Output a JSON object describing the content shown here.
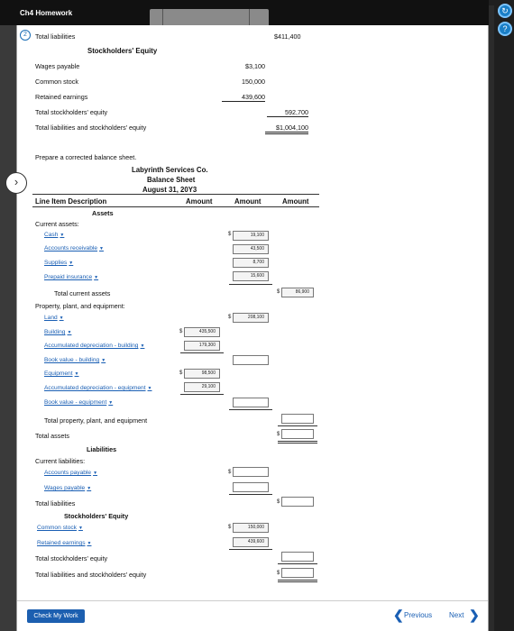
{
  "window": {
    "title": "Ch4 Homework"
  },
  "question": {
    "number": "2"
  },
  "top": {
    "total_liabilities_label": "Total liabilities",
    "total_liabilities_value": "$411,400",
    "se_heading": "Stockholders' Equity",
    "rows": [
      {
        "label": "Wages payable",
        "value": "$3,100"
      },
      {
        "label": "Common stock",
        "value": "150,000"
      },
      {
        "label": "Retained earnings",
        "value": "439,600"
      },
      {
        "label": "Total stockholders' equity",
        "value": "592,700"
      },
      {
        "label": "Total liabilities and stockholders' equity",
        "value": "$1,004,100"
      }
    ]
  },
  "prompt": "Prepare a corrected balance sheet.",
  "sheet": {
    "company": "Labyrinth Services Co.",
    "name": "Balance Sheet",
    "date": "August 31, 20Y3",
    "col_desc": "Line Item Description",
    "col_amount1": "Amount",
    "col_amount2": "Amount",
    "col_amount3": "Amount",
    "assets_heading": "Assets",
    "current_assets_label": "Current assets:",
    "cash": "Cash",
    "accounts_receivable": "Accounts receivable",
    "supplies": "Supplies",
    "prepaid_insurance": "Prepaid insurance",
    "cash_val": "19,100",
    "ar_val": "43,500",
    "supplies_val": "8,700",
    "prepaid_val": "15,600",
    "total_current_assets": "Total current assets",
    "total_current_assets_val": "86,900",
    "ppe_label": "Property, plant, and equipment:",
    "land": "Land",
    "land_val": "208,100",
    "building": "Building",
    "building_val": "435,500",
    "accum_dep_building": "Accumulated depreciation - building",
    "accum_dep_building_val": "179,300",
    "book_value_building": "Book value - building",
    "equipment": "Equipment",
    "equipment_val": "98,500",
    "accum_dep_equipment": "Accumulated depreciation - equipment",
    "accum_dep_equipment_val": "29,100",
    "book_value_equipment": "Book value - equipment",
    "total_ppe": "Total property, plant, and equipment",
    "total_assets": "Total assets",
    "liabilities_heading": "Liabilities",
    "current_liabilities_label": "Current liabilities:",
    "accounts_payable": "Accounts payable",
    "wages_payable": "Wages payable",
    "total_liabilities": "Total liabilities",
    "se_heading": "Stockholders' Equity",
    "common_stock": "Common stock",
    "common_stock_val": "150,000",
    "retained_earnings": "Retained earnings",
    "retained_earnings_val": "439,600",
    "total_se": "Total stockholders' equity",
    "total_l_se": "Total liabilities and stockholders' equity",
    "dollar": "$"
  },
  "footer": {
    "check_label": "Check My Work",
    "previous_label": "Previous",
    "next_label": "Next"
  },
  "icons": [
    "chevron-right-icon",
    "help-icon",
    "dropdown-caret-icon",
    "chevron-left-icon"
  ],
  "colors": {
    "link": "#1a5fb4",
    "button": "#1c5fb0"
  }
}
